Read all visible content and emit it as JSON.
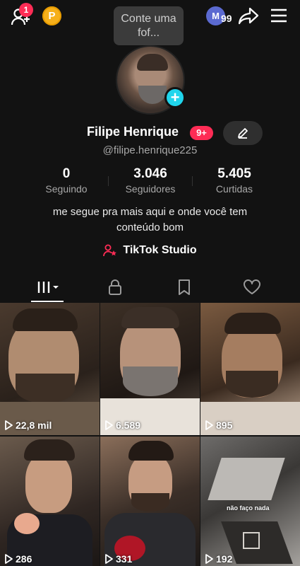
{
  "topbar": {
    "notification_count": "1",
    "coin_letter": "P",
    "tooltip_text": "Conte uma fof...",
    "account_initial": "M",
    "account_count": "99"
  },
  "profile": {
    "name": "Filipe Henrique",
    "badge": "9+",
    "handle": "@filipe.henrique225",
    "stats": [
      {
        "value": "0",
        "label": "Seguindo"
      },
      {
        "value": "3.046",
        "label": "Seguidores"
      },
      {
        "value": "5.405",
        "label": "Curtidas"
      }
    ],
    "bio_line1": "me segue pra mais aqui e onde você tem",
    "bio_line2": "conteúdo bom",
    "studio_label": "TikTok Studio"
  },
  "tabs": [
    "videos-tab",
    "private-tab",
    "saved-tab",
    "liked-tab"
  ],
  "videos": [
    {
      "views": "22,8 mil"
    },
    {
      "views": "6.589"
    },
    {
      "views": "895"
    },
    {
      "views": "286"
    },
    {
      "views": "331"
    },
    {
      "views": "192",
      "overlay": "não faço nada"
    }
  ],
  "colors": {
    "accent_red": "#fe2c55",
    "accent_cyan": "#20d5ec",
    "background": "#121212",
    "coin": "#f6b01b"
  }
}
